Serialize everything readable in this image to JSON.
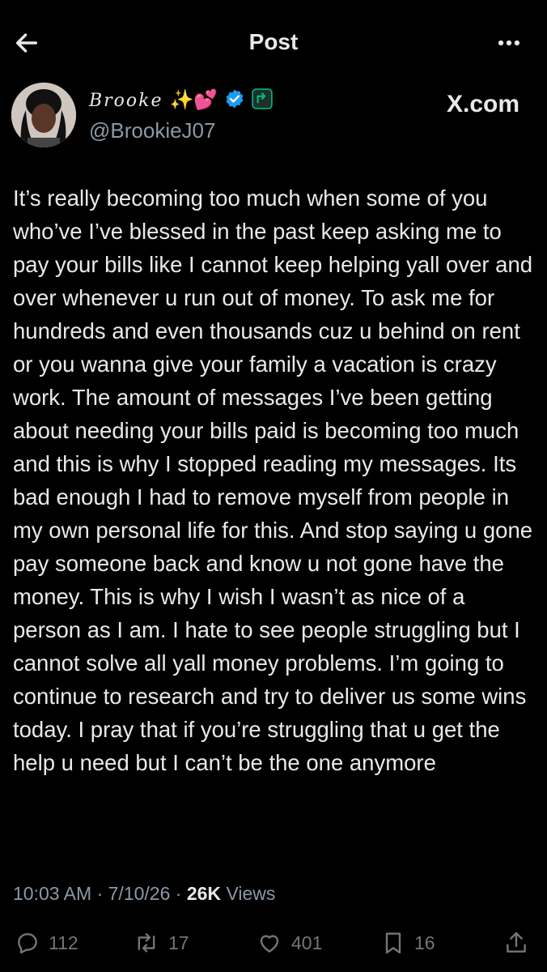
{
  "header": {
    "title": "Post"
  },
  "author": {
    "display_name": "Brooke",
    "emojis": "✨💕",
    "handle": "@BrookieJ07"
  },
  "brand_text": "X.com",
  "post": {
    "text": "It’s really becoming too much when some of you who’ve I’ve blessed in the past keep asking me to pay your bills like I cannot keep helping yall over and over whenever u run out of money. To ask me for hundreds and even thousands cuz u behind on rent or you wanna give your family a vacation is crazy work. The amount of messages I’ve been getting about needing your bills paid is becoming too much and this is why I stopped reading my messages. Its bad enough I had to remove myself from people in my own personal life for this. And stop saying u gone pay someone back and know u not gone have the money. This is why I wish I wasn’t as nice of a person as I am. I hate to see people struggling but I cannot solve all yall money problems. I’m going to continue to research and try to deliver us some wins today. I pray that if you’re struggling that u get the help u need but I can’t be the one anymore",
    "time": "10:03 AM",
    "date": "7/10/26",
    "views_count": "26K",
    "views_label": "Views"
  },
  "actions": {
    "replies": "112",
    "reposts": "17",
    "likes": "401",
    "bookmarks": "16"
  },
  "colors": {
    "background": "#000000",
    "text": "#e7e9ea",
    "muted": "#71767b",
    "verified": "#1d9bf0",
    "badge": "#00ba7c"
  }
}
